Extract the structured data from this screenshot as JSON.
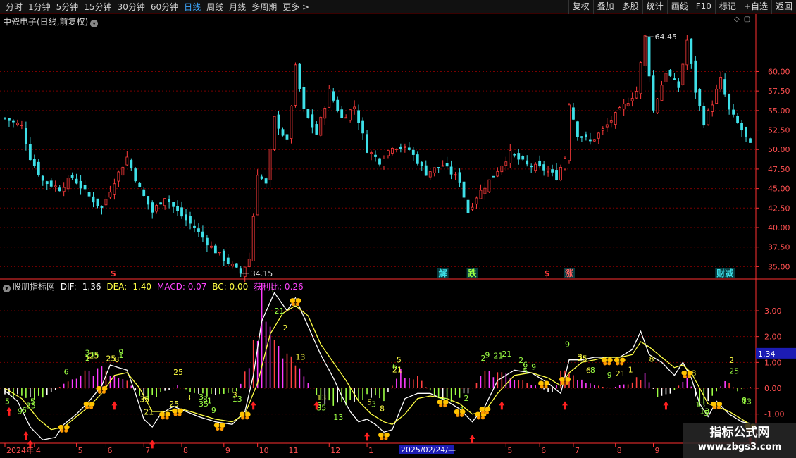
{
  "toolbar": {
    "periods": [
      "分时",
      "1分钟",
      "5分钟",
      "15分钟",
      "30分钟",
      "60分钟",
      "日线",
      "周线",
      "月线",
      "多周期",
      "更多 >"
    ],
    "active_period": "日线",
    "actions": [
      "复权",
      "叠加",
      "多股",
      "统计",
      "画线",
      "F10",
      "标记",
      "+自选",
      "返回"
    ]
  },
  "stock": {
    "title": "中瓷电子(日线,前复权)"
  },
  "indicator": {
    "name": "股朋指标网",
    "dif_label": "DIF: -1.36",
    "dea_label": "DEA: -1.40",
    "macd_label": "MACD: 0.07",
    "bc_label": "BC: 0.00",
    "profit_label": "获利比: 0.26",
    "current_value_tag": "1.34"
  },
  "colors": {
    "up": "#ff3b3b",
    "down": "#3ee0e8",
    "dif": "#ffffff",
    "dea": "#ffff44",
    "macd_pos": "#ff3bff",
    "macd_neg": "#9cff44",
    "grid": "#7a0000",
    "axis": "#ff3030",
    "cursor_date_bg": "#1c1cb4"
  },
  "chart_data": [
    {
      "type": "candlestick",
      "title": "中瓷电子(日线,前复权)",
      "y_ticks": [
        35.0,
        37.5,
        40.0,
        42.5,
        45.0,
        47.5,
        50.0,
        52.5,
        55.0,
        57.5,
        60.0
      ],
      "ylim": [
        33.5,
        66
      ],
      "annotations": [
        {
          "label": "64.45",
          "value": 64.45,
          "type": "high"
        },
        {
          "label": "34.15",
          "value": 34.15,
          "type": "low"
        }
      ],
      "signals": [
        {
          "index": 25,
          "label": "$",
          "color": "#ff3b3b"
        },
        {
          "index": 103,
          "label": "解",
          "color": "#3ee0e8"
        },
        {
          "index": 110,
          "label": "跌",
          "color": "#9cff44"
        },
        {
          "index": 128,
          "label": "$",
          "color": "#ff3b3b"
        },
        {
          "index": 133,
          "label": "涨",
          "color": "#ff6060"
        },
        {
          "index": 169,
          "label": "财减",
          "color": "#3ee0e8"
        }
      ],
      "waypoints": [
        [
          0,
          54
        ],
        [
          4,
          53
        ],
        [
          6,
          49
        ],
        [
          9,
          46
        ],
        [
          13,
          45
        ],
        [
          16,
          46.5
        ],
        [
          20,
          44
        ],
        [
          23,
          42.5
        ],
        [
          26,
          46
        ],
        [
          29,
          49
        ],
        [
          32,
          45
        ],
        [
          35,
          42
        ],
        [
          38,
          44
        ],
        [
          41,
          42
        ],
        [
          45,
          40
        ],
        [
          49,
          37.5
        ],
        [
          52,
          36
        ],
        [
          56,
          34.15
        ],
        [
          58,
          36
        ],
        [
          60,
          47
        ],
        [
          62,
          45.5
        ],
        [
          64,
          54
        ],
        [
          67,
          51
        ],
        [
          69,
          60.5
        ],
        [
          71,
          55
        ],
        [
          74,
          52
        ],
        [
          77,
          57.5
        ],
        [
          80,
          54
        ],
        [
          83,
          55.5
        ],
        [
          86,
          50
        ],
        [
          89,
          48.5
        ],
        [
          92,
          50.5
        ],
        [
          96,
          50
        ],
        [
          100,
          47
        ],
        [
          104,
          48
        ],
        [
          108,
          46
        ],
        [
          110,
          42
        ],
        [
          112,
          44
        ],
        [
          115,
          46
        ],
        [
          120,
          49.5
        ],
        [
          124,
          48
        ],
        [
          128,
          47.5
        ],
        [
          131,
          46.5
        ],
        [
          133,
          49
        ],
        [
          134,
          56
        ],
        [
          136,
          52
        ],
        [
          139,
          51
        ],
        [
          142,
          52.5
        ],
        [
          146,
          55
        ],
        [
          150,
          57.5
        ],
        [
          152,
          64.45
        ],
        [
          154,
          55
        ],
        [
          157,
          60
        ],
        [
          160,
          58
        ],
        [
          162,
          64
        ],
        [
          164,
          57.5
        ],
        [
          166,
          53.5
        ],
        [
          168,
          56
        ],
        [
          170,
          59
        ],
        [
          172,
          55
        ],
        [
          175,
          52.5
        ],
        [
          177,
          50.5
        ]
      ]
    },
    {
      "type": "macd",
      "title": "股朋指标网",
      "y_ticks": [
        -1.0,
        0.0,
        1.0,
        2.0,
        3.0
      ],
      "ylim": [
        -2.1,
        4.2
      ],
      "series": [
        {
          "name": "DIF",
          "waypoints": [
            [
              0,
              -0.1
            ],
            [
              3,
              -0.5
            ],
            [
              6,
              -1.5
            ],
            [
              9,
              -2.0
            ],
            [
              12,
              -1.9
            ],
            [
              14,
              -1.4
            ],
            [
              17,
              -1.0
            ],
            [
              20,
              -0.5
            ],
            [
              23,
              0.1
            ],
            [
              25,
              0.9
            ],
            [
              29,
              0.7
            ],
            [
              31,
              -0.2
            ],
            [
              33,
              -1.2
            ],
            [
              35,
              -1.5
            ],
            [
              37,
              -1.0
            ],
            [
              40,
              -0.7
            ],
            [
              43,
              -0.9
            ],
            [
              46,
              -1.1
            ],
            [
              50,
              -1.3
            ],
            [
              54,
              -1.4
            ],
            [
              57,
              -0.9
            ],
            [
              59,
              0.5
            ],
            [
              61,
              2.6
            ],
            [
              64,
              3.7
            ],
            [
              67,
              3.0
            ],
            [
              69,
              3.5
            ],
            [
              72,
              2.4
            ],
            [
              75,
              1.3
            ],
            [
              78,
              0.4
            ],
            [
              80,
              -0.3
            ],
            [
              82,
              -0.9
            ],
            [
              84,
              -1.3
            ],
            [
              86,
              -1.2
            ],
            [
              88,
              -1.4
            ],
            [
              90,
              -1.7
            ],
            [
              92,
              -1.6
            ],
            [
              95,
              -0.4
            ],
            [
              98,
              -0.2
            ],
            [
              101,
              -0.2
            ],
            [
              105,
              -0.5
            ],
            [
              108,
              -0.8
            ],
            [
              111,
              -1.3
            ],
            [
              114,
              -0.7
            ],
            [
              117,
              0.3
            ],
            [
              121,
              0.7
            ],
            [
              125,
              0.6
            ],
            [
              129,
              0.2
            ],
            [
              132,
              -0.2
            ],
            [
              134,
              1.1
            ],
            [
              137,
              1.1
            ],
            [
              140,
              1.2
            ],
            [
              143,
              1.2
            ],
            [
              146,
              1.2
            ],
            [
              149,
              1.5
            ],
            [
              151,
              2.2
            ],
            [
              153,
              1.3
            ],
            [
              156,
              1.0
            ],
            [
              159,
              0.5
            ],
            [
              161,
              1.0
            ],
            [
              163,
              0.4
            ],
            [
              165,
              -0.6
            ],
            [
              167,
              -1.1
            ],
            [
              169,
              -0.5
            ],
            [
              172,
              -1.0
            ],
            [
              175,
              -1.3
            ],
            [
              177,
              -1.36
            ]
          ]
        },
        {
          "name": "DEA",
          "waypoints": [
            [
              0,
              0.0
            ],
            [
              4,
              -0.4
            ],
            [
              8,
              -1.2
            ],
            [
              11,
              -1.6
            ],
            [
              14,
              -1.5
            ],
            [
              17,
              -1.1
            ],
            [
              20,
              -0.7
            ],
            [
              23,
              -0.2
            ],
            [
              26,
              0.5
            ],
            [
              29,
              0.6
            ],
            [
              32,
              0.0
            ],
            [
              35,
              -0.9
            ],
            [
              38,
              -0.9
            ],
            [
              42,
              -0.8
            ],
            [
              46,
              -1.0
            ],
            [
              50,
              -1.2
            ],
            [
              54,
              -1.3
            ],
            [
              57,
              -1.0
            ],
            [
              60,
              0.2
            ],
            [
              63,
              2.1
            ],
            [
              66,
              2.9
            ],
            [
              69,
              3.2
            ],
            [
              72,
              2.8
            ],
            [
              75,
              1.7
            ],
            [
              78,
              1.0
            ],
            [
              81,
              0.3
            ],
            [
              84,
              -0.5
            ],
            [
              87,
              -1.0
            ],
            [
              90,
              -1.3
            ],
            [
              92,
              -1.4
            ],
            [
              95,
              -1.0
            ],
            [
              98,
              -0.4
            ],
            [
              101,
              -0.3
            ],
            [
              105,
              -0.4
            ],
            [
              108,
              -0.6
            ],
            [
              111,
              -1.0
            ],
            [
              114,
              -0.9
            ],
            [
              117,
              -0.2
            ],
            [
              121,
              0.5
            ],
            [
              125,
              0.6
            ],
            [
              129,
              0.4
            ],
            [
              132,
              0.1
            ],
            [
              134,
              0.6
            ],
            [
              137,
              1.0
            ],
            [
              140,
              1.1
            ],
            [
              143,
              1.2
            ],
            [
              146,
              1.2
            ],
            [
              149,
              1.3
            ],
            [
              151,
              1.8
            ],
            [
              153,
              1.6
            ],
            [
              156,
              1.2
            ],
            [
              159,
              0.8
            ],
            [
              161,
              0.9
            ],
            [
              163,
              0.6
            ],
            [
              165,
              0.0
            ],
            [
              167,
              -0.6
            ],
            [
              169,
              -0.7
            ],
            [
              172,
              -0.9
            ],
            [
              175,
              -1.2
            ],
            [
              177,
              -1.4
            ]
          ]
        }
      ],
      "macd_waypoints": [
        [
          0,
          -0.2
        ],
        [
          6,
          -0.4
        ],
        [
          10,
          -0.3
        ],
        [
          14,
          0.2
        ],
        [
          18,
          0.5
        ],
        [
          22,
          0.7
        ],
        [
          26,
          0.6
        ],
        [
          30,
          0.1
        ],
        [
          33,
          -0.5
        ],
        [
          37,
          -0.2
        ],
        [
          41,
          0.1
        ],
        [
          45,
          -0.2
        ],
        [
          50,
          -0.3
        ],
        [
          55,
          -0.1
        ],
        [
          58,
          0.8
        ],
        [
          61,
          3.5
        ],
        [
          64,
          2.5
        ],
        [
          67,
          1.2
        ],
        [
          70,
          0.6
        ],
        [
          74,
          -0.2
        ],
        [
          78,
          -0.8
        ],
        [
          82,
          -0.5
        ],
        [
          86,
          -0.3
        ],
        [
          90,
          -0.4
        ],
        [
          94,
          0.6
        ],
        [
          98,
          0.4
        ],
        [
          102,
          -0.3
        ],
        [
          106,
          -0.4
        ],
        [
          110,
          -0.2
        ],
        [
          114,
          0.6
        ],
        [
          118,
          0.5
        ],
        [
          122,
          0.3
        ],
        [
          126,
          0.1
        ],
        [
          130,
          -0.2
        ],
        [
          133,
          0.9
        ],
        [
          136,
          0.4
        ],
        [
          140,
          0.1
        ],
        [
          144,
          0.0
        ],
        [
          148,
          0.2
        ],
        [
          152,
          0.5
        ],
        [
          155,
          -0.3
        ],
        [
          158,
          -0.2
        ],
        [
          162,
          0.4
        ],
        [
          165,
          -0.6
        ],
        [
          168,
          -0.3
        ],
        [
          171,
          0.3
        ],
        [
          174,
          -0.1
        ],
        [
          177,
          0.07
        ]
      ],
      "x_ticks": [
        {
          "index": 0,
          "label": "2024年"
        },
        {
          "index": 7,
          "label": "4"
        },
        {
          "index": 17,
          "label": "5"
        },
        {
          "index": 24,
          "label": "6"
        },
        {
          "index": 33,
          "label": "7"
        },
        {
          "index": 42,
          "label": "8"
        },
        {
          "index": 52,
          "label": "9"
        },
        {
          "index": 60,
          "label": "10"
        },
        {
          "index": 67,
          "label": "11"
        },
        {
          "index": 77,
          "label": "12"
        },
        {
          "index": 86,
          "label": "1"
        },
        {
          "index": 94,
          "label": "2025/02/24/—",
          "cursor": true
        },
        {
          "index": 119,
          "label": "5"
        },
        {
          "index": 127,
          "label": "6"
        },
        {
          "index": 135,
          "label": "7"
        },
        {
          "index": 145,
          "label": "8"
        },
        {
          "index": 154,
          "label": "9"
        }
      ],
      "markers": {
        "numbers": [
          "8",
          "9",
          "13",
          "5",
          "21",
          "3",
          "2",
          "1",
          "6",
          "25",
          "35"
        ],
        "butterfly_indices": [
          14,
          20,
          23,
          38,
          41,
          51,
          57,
          69,
          90,
          104,
          108,
          113,
          114,
          128,
          133,
          143,
          146,
          162,
          169,
          178
        ],
        "arrow_indices": [
          1,
          5,
          6,
          26,
          35,
          59,
          74,
          86,
          111,
          118,
          133,
          157,
          177
        ]
      }
    }
  ],
  "watermark": {
    "title": "指标公式网",
    "url": "www.zbgs3.com"
  }
}
